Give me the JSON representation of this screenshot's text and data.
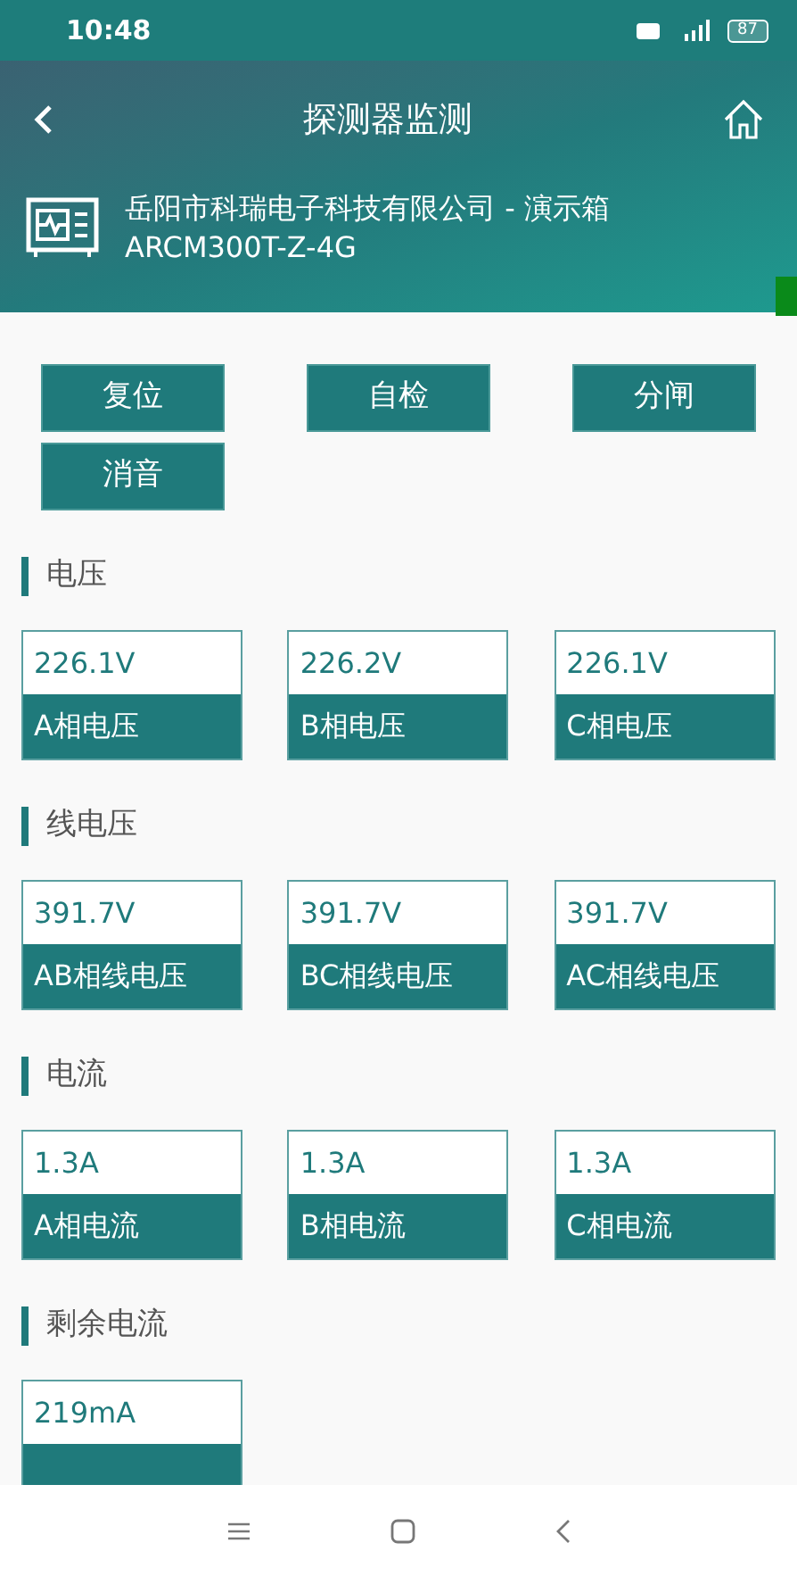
{
  "status_bar": {
    "time": "10:48",
    "battery": "87"
  },
  "header": {
    "title": "探测器监测",
    "device_name": "岳阳市科瑞电子科技有限公司 - 演示箱",
    "device_model": "ARCM300T-Z-4G"
  },
  "remote_control": {
    "buttons": [
      "复位",
      "自检",
      "分闸",
      "消音"
    ]
  },
  "sections": [
    {
      "title": "电压",
      "cards": [
        {
          "value": "226.1V",
          "label": "A相电压"
        },
        {
          "value": "226.2V",
          "label": "B相电压"
        },
        {
          "value": "226.1V",
          "label": "C相电压"
        }
      ]
    },
    {
      "title": "线电压",
      "cards": [
        {
          "value": "391.7V",
          "label": "AB相线电压"
        },
        {
          "value": "391.7V",
          "label": "BC相线电压"
        },
        {
          "value": "391.7V",
          "label": "AC相线电压"
        }
      ]
    },
    {
      "title": "电流",
      "cards": [
        {
          "value": "1.3A",
          "label": "A相电流"
        },
        {
          "value": "1.3A",
          "label": "B相电流"
        },
        {
          "value": "1.3A",
          "label": "C相电流"
        }
      ]
    },
    {
      "title": "剩余电流",
      "cards": [
        {
          "value": "219mA"
        }
      ]
    }
  ]
}
